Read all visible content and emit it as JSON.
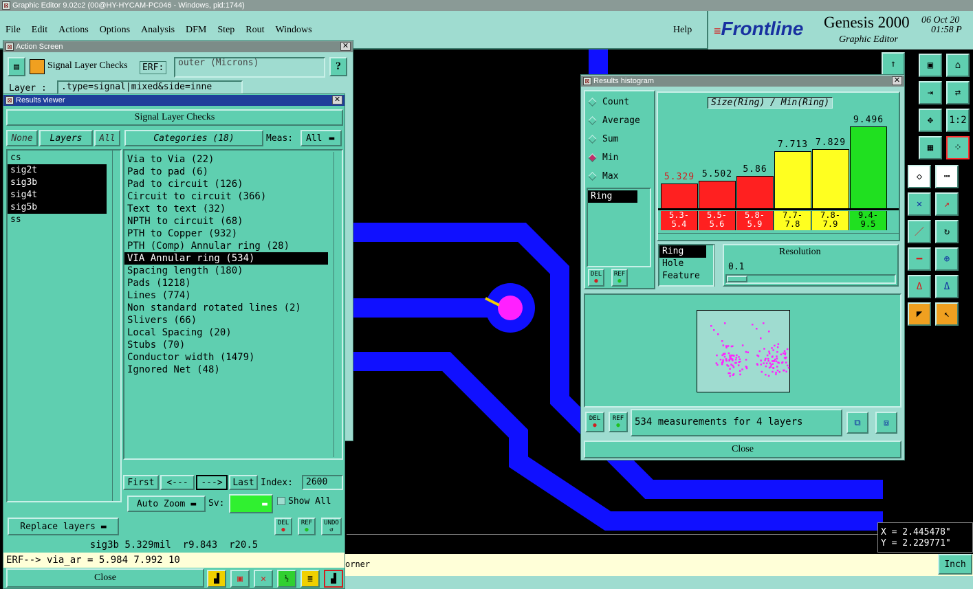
{
  "app": {
    "title": "Graphic Editor 9.02c2 (00@HY-HYCAM-PC046 - Windows, pid:1744)"
  },
  "menu": {
    "items": [
      "File",
      "Edit",
      "Actions",
      "Options",
      "Analysis",
      "DFM",
      "Step",
      "Rout",
      "Windows"
    ],
    "help": "Help"
  },
  "brand": {
    "logo": "Frontline",
    "product": "Genesis 2000",
    "subtitle": "Graphic Editor",
    "date": "06 Oct 20",
    "time": "01:58 P"
  },
  "action_screen": {
    "title": "Action Screen",
    "name": "Signal Layer Checks",
    "erf_label": "ERF:",
    "erf_value": "outer (Microns)",
    "help": "?",
    "layer_label": "Layer :",
    "layer_value": ".type=signal|mixed&side=inne"
  },
  "results_viewer": {
    "title": "Results viewer",
    "header": "Signal Layer Checks",
    "none_label": "None",
    "layers_label": "Layers",
    "all_label": "All",
    "categories_label": "Categories (18)",
    "meas_label": "Meas:",
    "meas_value": "All",
    "layers": [
      {
        "name": "cs",
        "selected": false
      },
      {
        "name": "sig2t",
        "selected": true
      },
      {
        "name": "sig3b",
        "selected": true
      },
      {
        "name": "sig4t",
        "selected": true
      },
      {
        "name": "sig5b",
        "selected": true
      },
      {
        "name": "ss",
        "selected": false
      }
    ],
    "categories": [
      "Via to Via (22)",
      "Pad to pad (6)",
      "Pad to circuit (126)",
      "Circuit to circuit (366)",
      "Text to text (32)",
      "NPTH to circuit (68)",
      "PTH to Copper (932)",
      "PTH (Comp) Annular ring (28)",
      "VIA Annular ring (534)",
      "Spacing length (180)",
      "Pads (1218)",
      "Lines (774)",
      "Non standard rotated lines (2)",
      "Slivers (66)",
      "Local Spacing (20)",
      "Stubs (70)",
      "Conductor width (1479)",
      "Ignored Net (48)"
    ],
    "selected_category": 8,
    "first": "First",
    "prev": "<---",
    "next": "--->",
    "last": "Last",
    "index_label": "Index:",
    "index_value": "2600",
    "auto_zoom": "Auto Zoom",
    "sv_label": "Sv:",
    "show_all": "Show All",
    "replace_layers": "Replace layers",
    "del": "DEL",
    "ref": "REF",
    "undo": "UNDO",
    "status": "sig3b 5.329mil  r9.843  r20.5",
    "erf_line": "ERF--> via_ar = 5.984 7.992 10",
    "close": "Close"
  },
  "histogram": {
    "title": "Results histogram",
    "heading": "Size(Ring) / Min(Ring)",
    "modes": [
      {
        "label": "Count",
        "on": false
      },
      {
        "label": "Average",
        "on": false
      },
      {
        "label": "Sum",
        "on": false
      },
      {
        "label": "Min",
        "on": true
      },
      {
        "label": "Max",
        "on": false
      }
    ],
    "measure_list": [
      "Ring"
    ],
    "type_list": [
      "Ring",
      "Hole",
      "Feature"
    ],
    "resolution_label": "Resolution",
    "resolution_value": "0.1",
    "summary": "534 measurements for 4 layers",
    "close": "Close",
    "del": "DEL",
    "ref": "REF",
    "colors": {
      "red": "#ff2020",
      "yellow": "#ffff20",
      "green": "#20e020"
    }
  },
  "chart_data": {
    "type": "bar",
    "title": "Size(Ring) / Min(Ring)",
    "categories": [
      "5.3-5.4",
      "5.5-5.6",
      "5.8-5.9",
      "7.7-7.8",
      "7.8-7.9",
      "9.4-9.5"
    ],
    "range_top": [
      "5.3-",
      "5.5-",
      "5.8-",
      "7.7-",
      "7.8-",
      "9.4-"
    ],
    "range_bottom": [
      "5.4",
      "5.6",
      "5.9",
      "7.8",
      "7.9",
      "9.5"
    ],
    "values": [
      5.329,
      5.502,
      5.86,
      7.713,
      7.829,
      9.496
    ],
    "labels": [
      "5.329",
      "5.502",
      "5.86",
      "7.713",
      "7.829",
      "9.496"
    ],
    "bar_colors": [
      "#ff2020",
      "#ff2020",
      "#ff2020",
      "#ffff20",
      "#ffff20",
      "#20e020"
    ],
    "ylim": [
      0,
      10
    ]
  },
  "status_bar": {
    "text": "orner",
    "unit": "Inch",
    "x": "X = 2.445478\"",
    "y": "Y = 2.229771\""
  }
}
